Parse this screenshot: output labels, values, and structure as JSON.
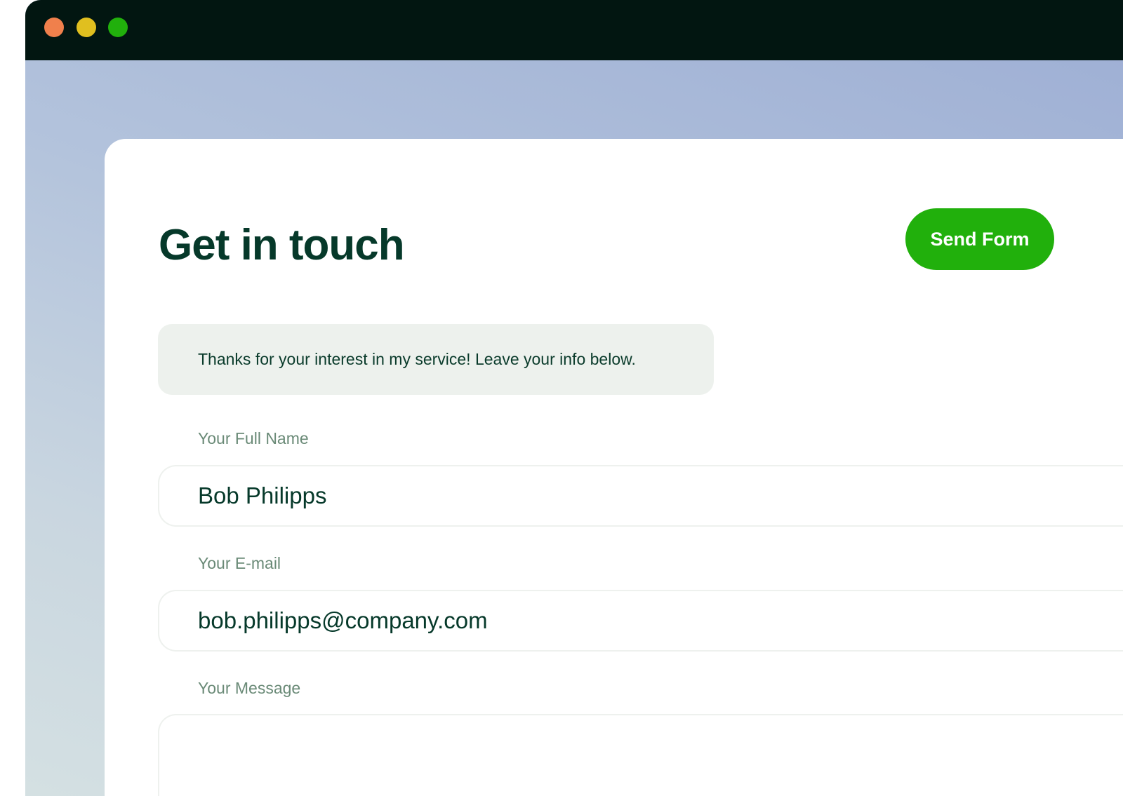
{
  "window": {
    "controls": {
      "close_color": "#f0804c",
      "minimize_color": "#e0bf1f",
      "maximize_color": "#21b00c"
    }
  },
  "form": {
    "title": "Get in touch",
    "send_label": "Send Form",
    "send_color": "#21b00c",
    "intro": "Thanks for your interest in my service! Leave your info below.",
    "fields": {
      "name": {
        "label": "Your Full Name",
        "value": "Bob Philipps"
      },
      "email": {
        "label": "Your E-mail",
        "value": "bob.philipps@company.com"
      },
      "message": {
        "label": "Your Message",
        "value": ""
      }
    }
  }
}
